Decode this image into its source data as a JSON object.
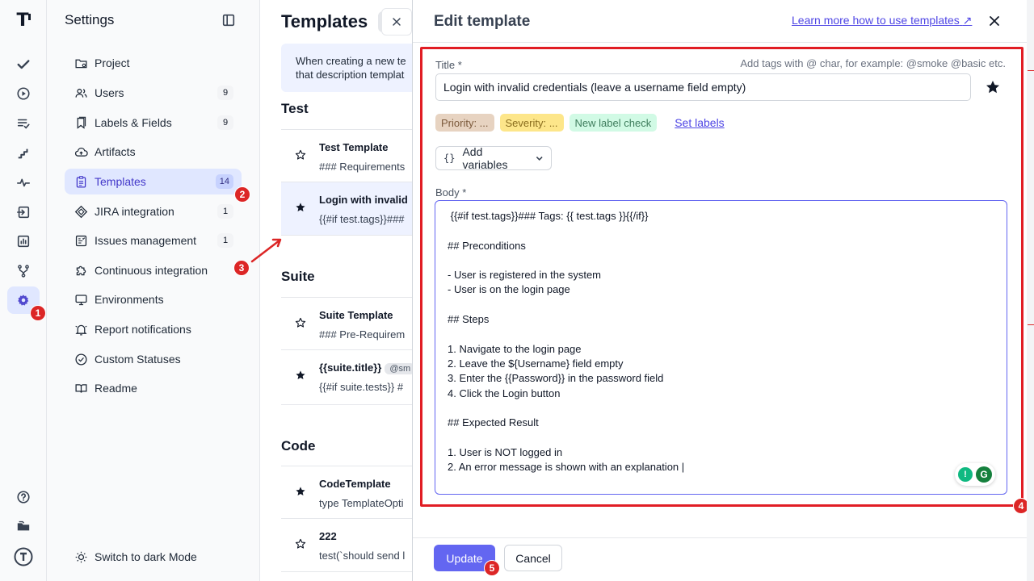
{
  "rail": {
    "items": [
      {
        "name": "logo",
        "icon": "logo-icon"
      },
      {
        "name": "tests",
        "icon": "checkmark-icon"
      },
      {
        "name": "runs",
        "icon": "play-circle-icon"
      },
      {
        "name": "plans",
        "icon": "list-check-icon"
      },
      {
        "name": "steps",
        "icon": "stairs-icon"
      },
      {
        "name": "pulse",
        "icon": "pulse-icon"
      },
      {
        "name": "imports",
        "icon": "import-icon"
      },
      {
        "name": "analytics",
        "icon": "bar-chart-icon"
      },
      {
        "name": "branches",
        "icon": "branch-icon"
      },
      {
        "name": "settings",
        "icon": "gear-icon"
      }
    ],
    "bottom": [
      {
        "name": "help",
        "icon": "help-circle-icon"
      },
      {
        "name": "projects",
        "icon": "folder-icon"
      },
      {
        "name": "account",
        "icon": "account-logo-icon"
      }
    ]
  },
  "settings": {
    "title": "Settings",
    "items": [
      {
        "label": "Project",
        "count": "",
        "icon": "folder-gear-icon"
      },
      {
        "label": "Users",
        "count": "9",
        "icon": "users-icon"
      },
      {
        "label": "Labels & Fields",
        "count": "9",
        "icon": "bookmark-icon"
      },
      {
        "label": "Artifacts",
        "count": "",
        "icon": "cloud-upload-icon"
      },
      {
        "label": "Templates",
        "count": "14",
        "icon": "clipboard-icon"
      },
      {
        "label": "JIRA integration",
        "count": "1",
        "icon": "jira-icon"
      },
      {
        "label": "Issues management",
        "count": "1",
        "icon": "issues-icon"
      },
      {
        "label": "Continuous integration",
        "count": "",
        "icon": "puzzle-icon"
      },
      {
        "label": "Environments",
        "count": "",
        "icon": "monitor-icon"
      },
      {
        "label": "Report notifications",
        "count": "",
        "icon": "bell-icon"
      },
      {
        "label": "Custom Statuses",
        "count": "",
        "icon": "check-circle-icon"
      },
      {
        "label": "Readme",
        "count": "",
        "icon": "book-icon"
      }
    ],
    "dark_mode": "Switch to dark Mode"
  },
  "templates": {
    "title": "Templates",
    "info": [
      "When creating a new te",
      "that description templat"
    ],
    "sections": {
      "test": "Test",
      "suite": "Suite",
      "code": "Code"
    },
    "rows": [
      {
        "name": "Test Template",
        "sub": "### Requirements",
        "starred": false
      },
      {
        "name": "Login with invalid",
        "sub": "{{#if test.tags}}###",
        "starred": true
      },
      {
        "name": "Suite Template",
        "sub": "### Pre-Requirem",
        "starred": false
      },
      {
        "name": "{{suite.title}}",
        "chip": "@sm",
        "sub": "{{#if suite.tests}} #",
        "starred": true
      },
      {
        "name": "CodeTemplate",
        "sub": "type TemplateOpti",
        "starred": true
      },
      {
        "name": "222",
        "sub": "test(`should send l",
        "starred": false
      }
    ]
  },
  "panel": {
    "title": "Edit template",
    "learn_link": "Learn more how to use templates",
    "title_label": "Title *",
    "title_hint": "Add tags with @ char, for example: @smoke @basic etc.",
    "title_value": "Login with invalid credentials (leave a username field empty)",
    "labels": [
      "Priority: ...",
      "Severity: ...",
      "New label check"
    ],
    "set_labels": "Set labels",
    "add_variables": "Add variables",
    "body_label": "Body *",
    "body_lines": [
      " {{#if test.tags}}### Tags: {{ test.tags }}{{/if}}",
      "",
      "## Preconditions",
      "",
      "- User is registered in the system",
      "- User is on the login page",
      "",
      "## Steps",
      "",
      "1. Navigate to the login page",
      "2. Leave the ${Username} field empty",
      "3. Enter the {{Password}} in the password field",
      "4. Click the Login button",
      "",
      "## Expected Result",
      "",
      "1. User is NOT logged in",
      "2. An error message is shown with an explanation |"
    ],
    "update": "Update",
    "cancel": "Cancel"
  },
  "markers": [
    "1",
    "2",
    "3",
    "4",
    "5"
  ],
  "colors": {
    "accent": "#6366f1",
    "highlight": "#e11d24",
    "active_bg": "#e0e7ff"
  }
}
